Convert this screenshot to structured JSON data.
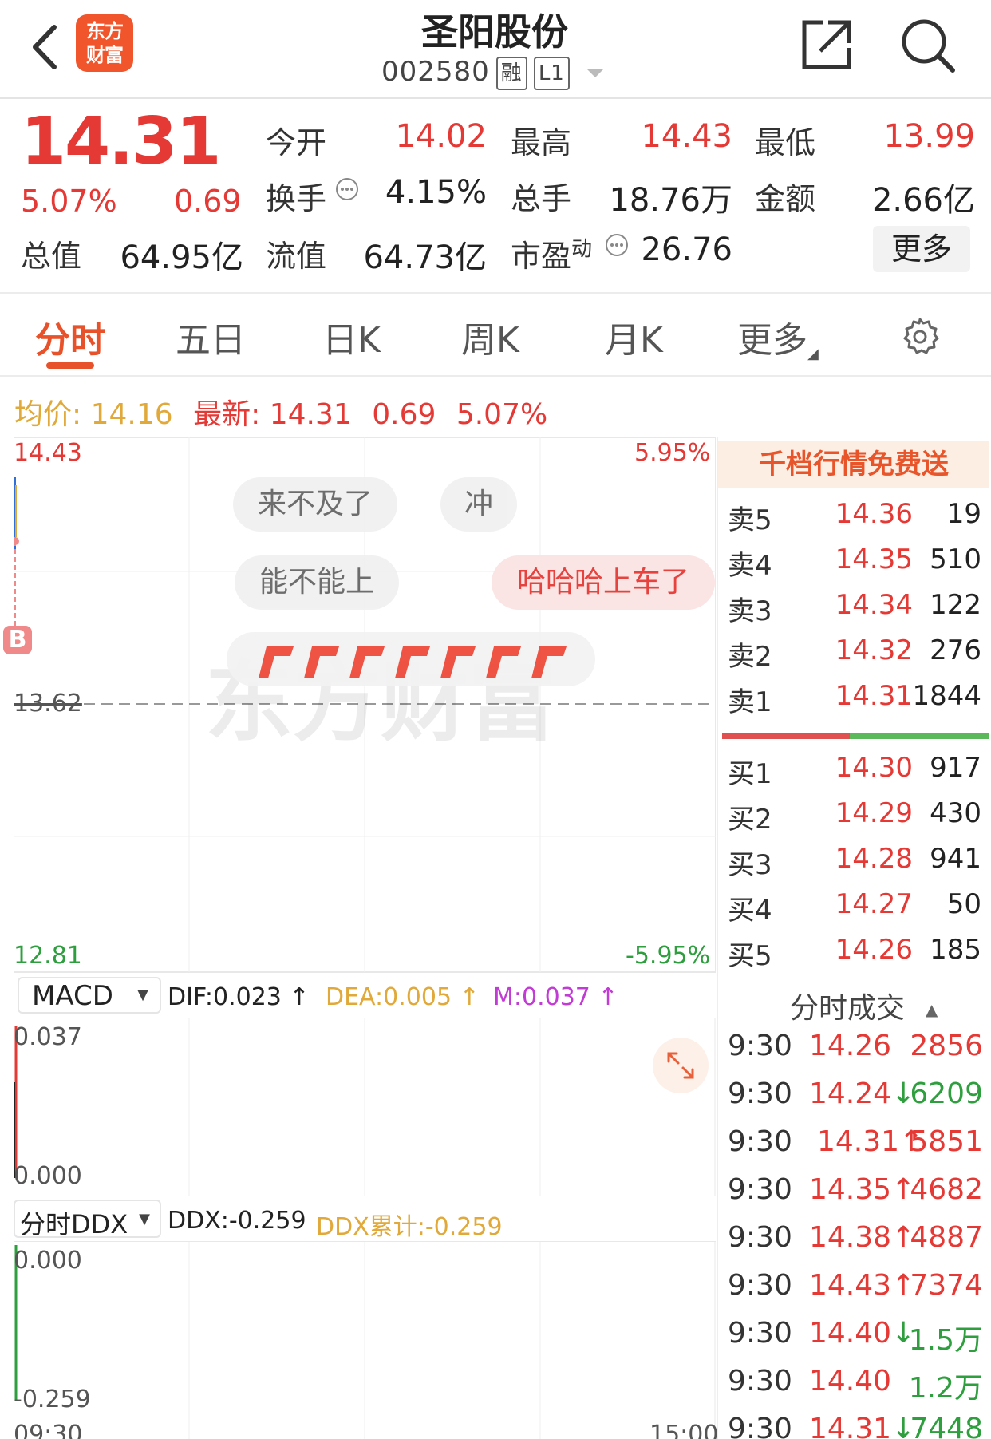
{
  "header": {
    "logo_line1": "东方",
    "logo_line2": "财富",
    "stock_name": "圣阳股份",
    "stock_code": "002580",
    "tag_margin": "融",
    "tag_level": "L1"
  },
  "quote": {
    "price": "14.31",
    "change_pct": "5.07%",
    "change": "0.69",
    "fields": [
      {
        "label": "今开",
        "value": "14.02",
        "color": "red"
      },
      {
        "label": "最高",
        "value": "14.43",
        "color": "red"
      },
      {
        "label": "最低",
        "value": "13.99",
        "color": "red"
      },
      {
        "label": "换手",
        "value": "4.15%",
        "color": "dark"
      },
      {
        "label": "总手",
        "value": "18.76万",
        "color": "dark"
      },
      {
        "label": "金额",
        "value": "2.66亿",
        "color": "dark"
      },
      {
        "label": "总值",
        "value": "64.95亿",
        "color": "dark"
      },
      {
        "label": "流值",
        "value": "64.73亿",
        "color": "dark"
      },
      {
        "label": "市盈",
        "sup": "动",
        "value": "26.76",
        "color": "dark"
      }
    ],
    "more_label": "更多"
  },
  "tabs": [
    "分时",
    "五日",
    "日K",
    "周K",
    "月K",
    "更多"
  ],
  "active_tab": 0,
  "info_line": {
    "avg_label": "均价:",
    "avg_value": "14.16",
    "latest_label": "最新:",
    "latest_value": "14.31",
    "latest_change": "0.69",
    "latest_pct": "5.07%"
  },
  "chart_data": {
    "type": "line",
    "y_max": "14.43",
    "y_mid": "13.62",
    "y_min": "12.81",
    "pct_max": "5.95%",
    "pct_min": "-5.95%",
    "x_start": "09:30",
    "x_end": "15:00",
    "buy_marker": "B"
  },
  "bubbles": [
    "来不及了",
    "冲",
    "能不能上",
    "哈哈哈上车了"
  ],
  "watermark": "东方财富",
  "order_book": {
    "banner": "千档行情免费送",
    "asks": [
      {
        "name": "卖5",
        "price": "14.36",
        "vol": "19"
      },
      {
        "name": "卖4",
        "price": "14.35",
        "vol": "510"
      },
      {
        "name": "卖3",
        "price": "14.34",
        "vol": "122"
      },
      {
        "name": "卖2",
        "price": "14.32",
        "vol": "276"
      },
      {
        "name": "卖1",
        "price": "14.31",
        "vol": "1844"
      }
    ],
    "bids": [
      {
        "name": "买1",
        "price": "14.30",
        "vol": "917"
      },
      {
        "name": "买2",
        "price": "14.29",
        "vol": "430"
      },
      {
        "name": "买3",
        "price": "14.28",
        "vol": "941"
      },
      {
        "name": "买4",
        "price": "14.27",
        "vol": "50"
      },
      {
        "name": "买5",
        "price": "14.26",
        "vol": "185"
      }
    ]
  },
  "ticks": {
    "title": "分时成交",
    "rows": [
      {
        "time": "9:30",
        "price": "14.26",
        "dir": "",
        "vol": "2856",
        "color": "red"
      },
      {
        "time": "9:30",
        "price": "14.24",
        "dir": "↓",
        "vol": "6209",
        "color": "green"
      },
      {
        "time": "9:30",
        "price": "14.31",
        "dir": "↑",
        "vol": "5851",
        "color": "red"
      },
      {
        "time": "9:30",
        "price": "14.35",
        "dir": "↑",
        "vol": "4682",
        "color": "red"
      },
      {
        "time": "9:30",
        "price": "14.38",
        "dir": "↑",
        "vol": "4887",
        "color": "red"
      },
      {
        "time": "9:30",
        "price": "14.43",
        "dir": "↑",
        "vol": "7374",
        "color": "red"
      },
      {
        "time": "9:30",
        "price": "14.40",
        "dir": "↓",
        "vol": "1.5万",
        "color": "green"
      },
      {
        "time": "9:30",
        "price": "14.40",
        "dir": "",
        "vol": "1.2万",
        "color": "green"
      },
      {
        "time": "9:30",
        "price": "14.31",
        "dir": "↓",
        "vol": "7448",
        "color": "green"
      }
    ]
  },
  "macd": {
    "selector": "MACD",
    "dif": "DIF:0.023 ↑",
    "dea": "DEA:0.005 ↑",
    "m": "M:0.037 ↑",
    "y_top": "0.037",
    "y_bottom": "0.000"
  },
  "ddx": {
    "selector": "分时DDX",
    "ddx": "DDX:-0.259",
    "ddx_cum": "DDX累计:-0.259",
    "y_top": "0.000",
    "y_bottom": "-0.259"
  },
  "colors": {
    "up": "#e53935",
    "down": "#2e9e3e",
    "accent": "#e8522a",
    "avg": "#e0a93a"
  }
}
